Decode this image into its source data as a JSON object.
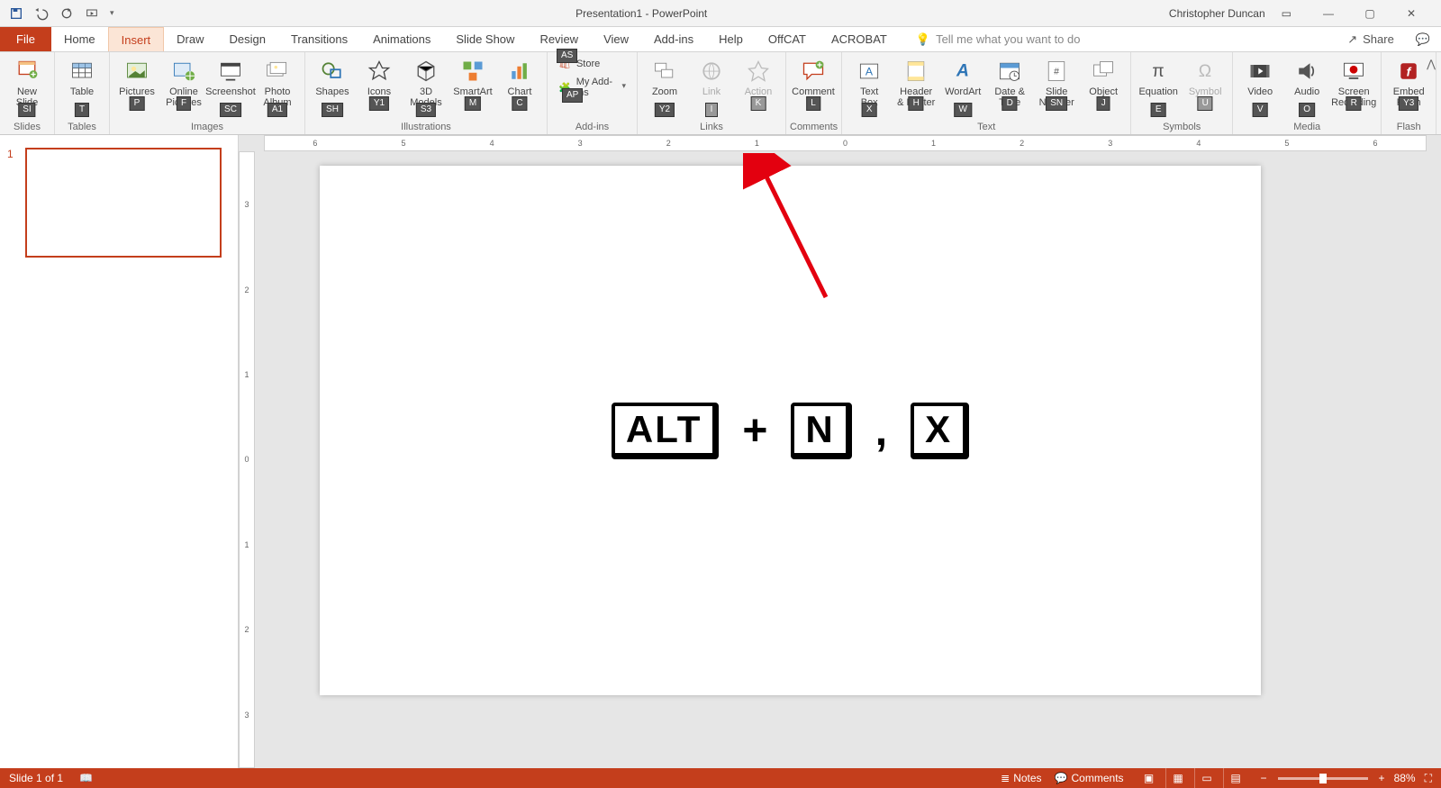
{
  "title": "Presentation1 - PowerPoint",
  "user": "Christopher Duncan",
  "qat": {
    "save_tip": "Save",
    "undo_tip": "Undo",
    "redo_tip": "Repeat",
    "start_tip": "Start From Beginning"
  },
  "tabs": [
    "File",
    "Home",
    "Insert",
    "Draw",
    "Design",
    "Transitions",
    "Animations",
    "Slide Show",
    "Review",
    "View",
    "Add-ins",
    "Help",
    "OffCAT",
    "ACROBAT"
  ],
  "active_tab": "Insert",
  "tell_me": "Tell me what you want to do",
  "share": "Share",
  "groups": {
    "slides": {
      "label": "Slides",
      "new_slide": "New\nSlide",
      "kt": "SI"
    },
    "tables": {
      "label": "Tables",
      "table": "Table",
      "kt": "T"
    },
    "images": {
      "label": "Images",
      "pictures": "Pictures",
      "kt_pictures": "P",
      "online": "Online\nPictures",
      "kt_online": "F",
      "screenshot": "Screenshot",
      "kt_screenshot": "SC",
      "album": "Photo\nAlbum",
      "kt_album": "A1"
    },
    "illus": {
      "label": "Illustrations",
      "shapes": "Shapes",
      "kt_shapes": "SH",
      "icons": "Icons",
      "kt_icons": "Y1",
      "models": "3D\nModels",
      "kt_models": "S3",
      "smartart": "SmartArt",
      "kt_smart": "M",
      "chart": "Chart",
      "kt_chart": "C"
    },
    "addins": {
      "label": "Add-ins",
      "store": "Store",
      "kt_store": "AS",
      "myaddins": "My Add-ins",
      "kt_my": "AP"
    },
    "links": {
      "label": "Links",
      "zoom": "Zoom",
      "kt_zoom": "Y2",
      "link": "Link",
      "kt_link": "I",
      "action": "Action",
      "kt_action": "K"
    },
    "comments": {
      "label": "Comments",
      "comment": "Comment",
      "kt_comment": "L"
    },
    "text": {
      "label": "Text",
      "textbox": "Text\nBox",
      "kt_textbox": "X",
      "header": "Header\n& Footer",
      "kt_header": "H",
      "wordart": "WordArt",
      "kt_wordart": "W",
      "datetime": "Date &\nTime",
      "kt_date": "D",
      "slidenum": "Slide\nNumber",
      "kt_sn": "SN",
      "object": "Object",
      "kt_obj": "J"
    },
    "symbols": {
      "label": "Symbols",
      "equation": "Equation",
      "kt_eq": "E",
      "symbol": "Symbol",
      "kt_sym": "U"
    },
    "media": {
      "label": "Media",
      "video": "Video",
      "kt_video": "V",
      "audio": "Audio",
      "kt_audio": "O",
      "screen": "Screen\nRecording",
      "kt_screen": "R"
    },
    "flash": {
      "label": "Flash",
      "flash": "Embed\nFlash",
      "kt_flash": "Y3"
    }
  },
  "ruler_h": [
    "6",
    "5",
    "4",
    "3",
    "2",
    "1",
    "0",
    "1",
    "2",
    "3",
    "4",
    "5",
    "6"
  ],
  "ruler_v": [
    "3",
    "2",
    "1",
    "0",
    "1",
    "2",
    "3"
  ],
  "thumbs": {
    "slide1_num": "1"
  },
  "slide_content": {
    "key1": "ALT",
    "plus": "+",
    "key2": "N",
    "comma": ",",
    "key3": "X"
  },
  "status": {
    "slide_info": "Slide 1 of 1",
    "notes": "Notes",
    "comments": "Comments",
    "zoom": "88%",
    "zoom_plus": "+",
    "zoom_minus": "−"
  }
}
